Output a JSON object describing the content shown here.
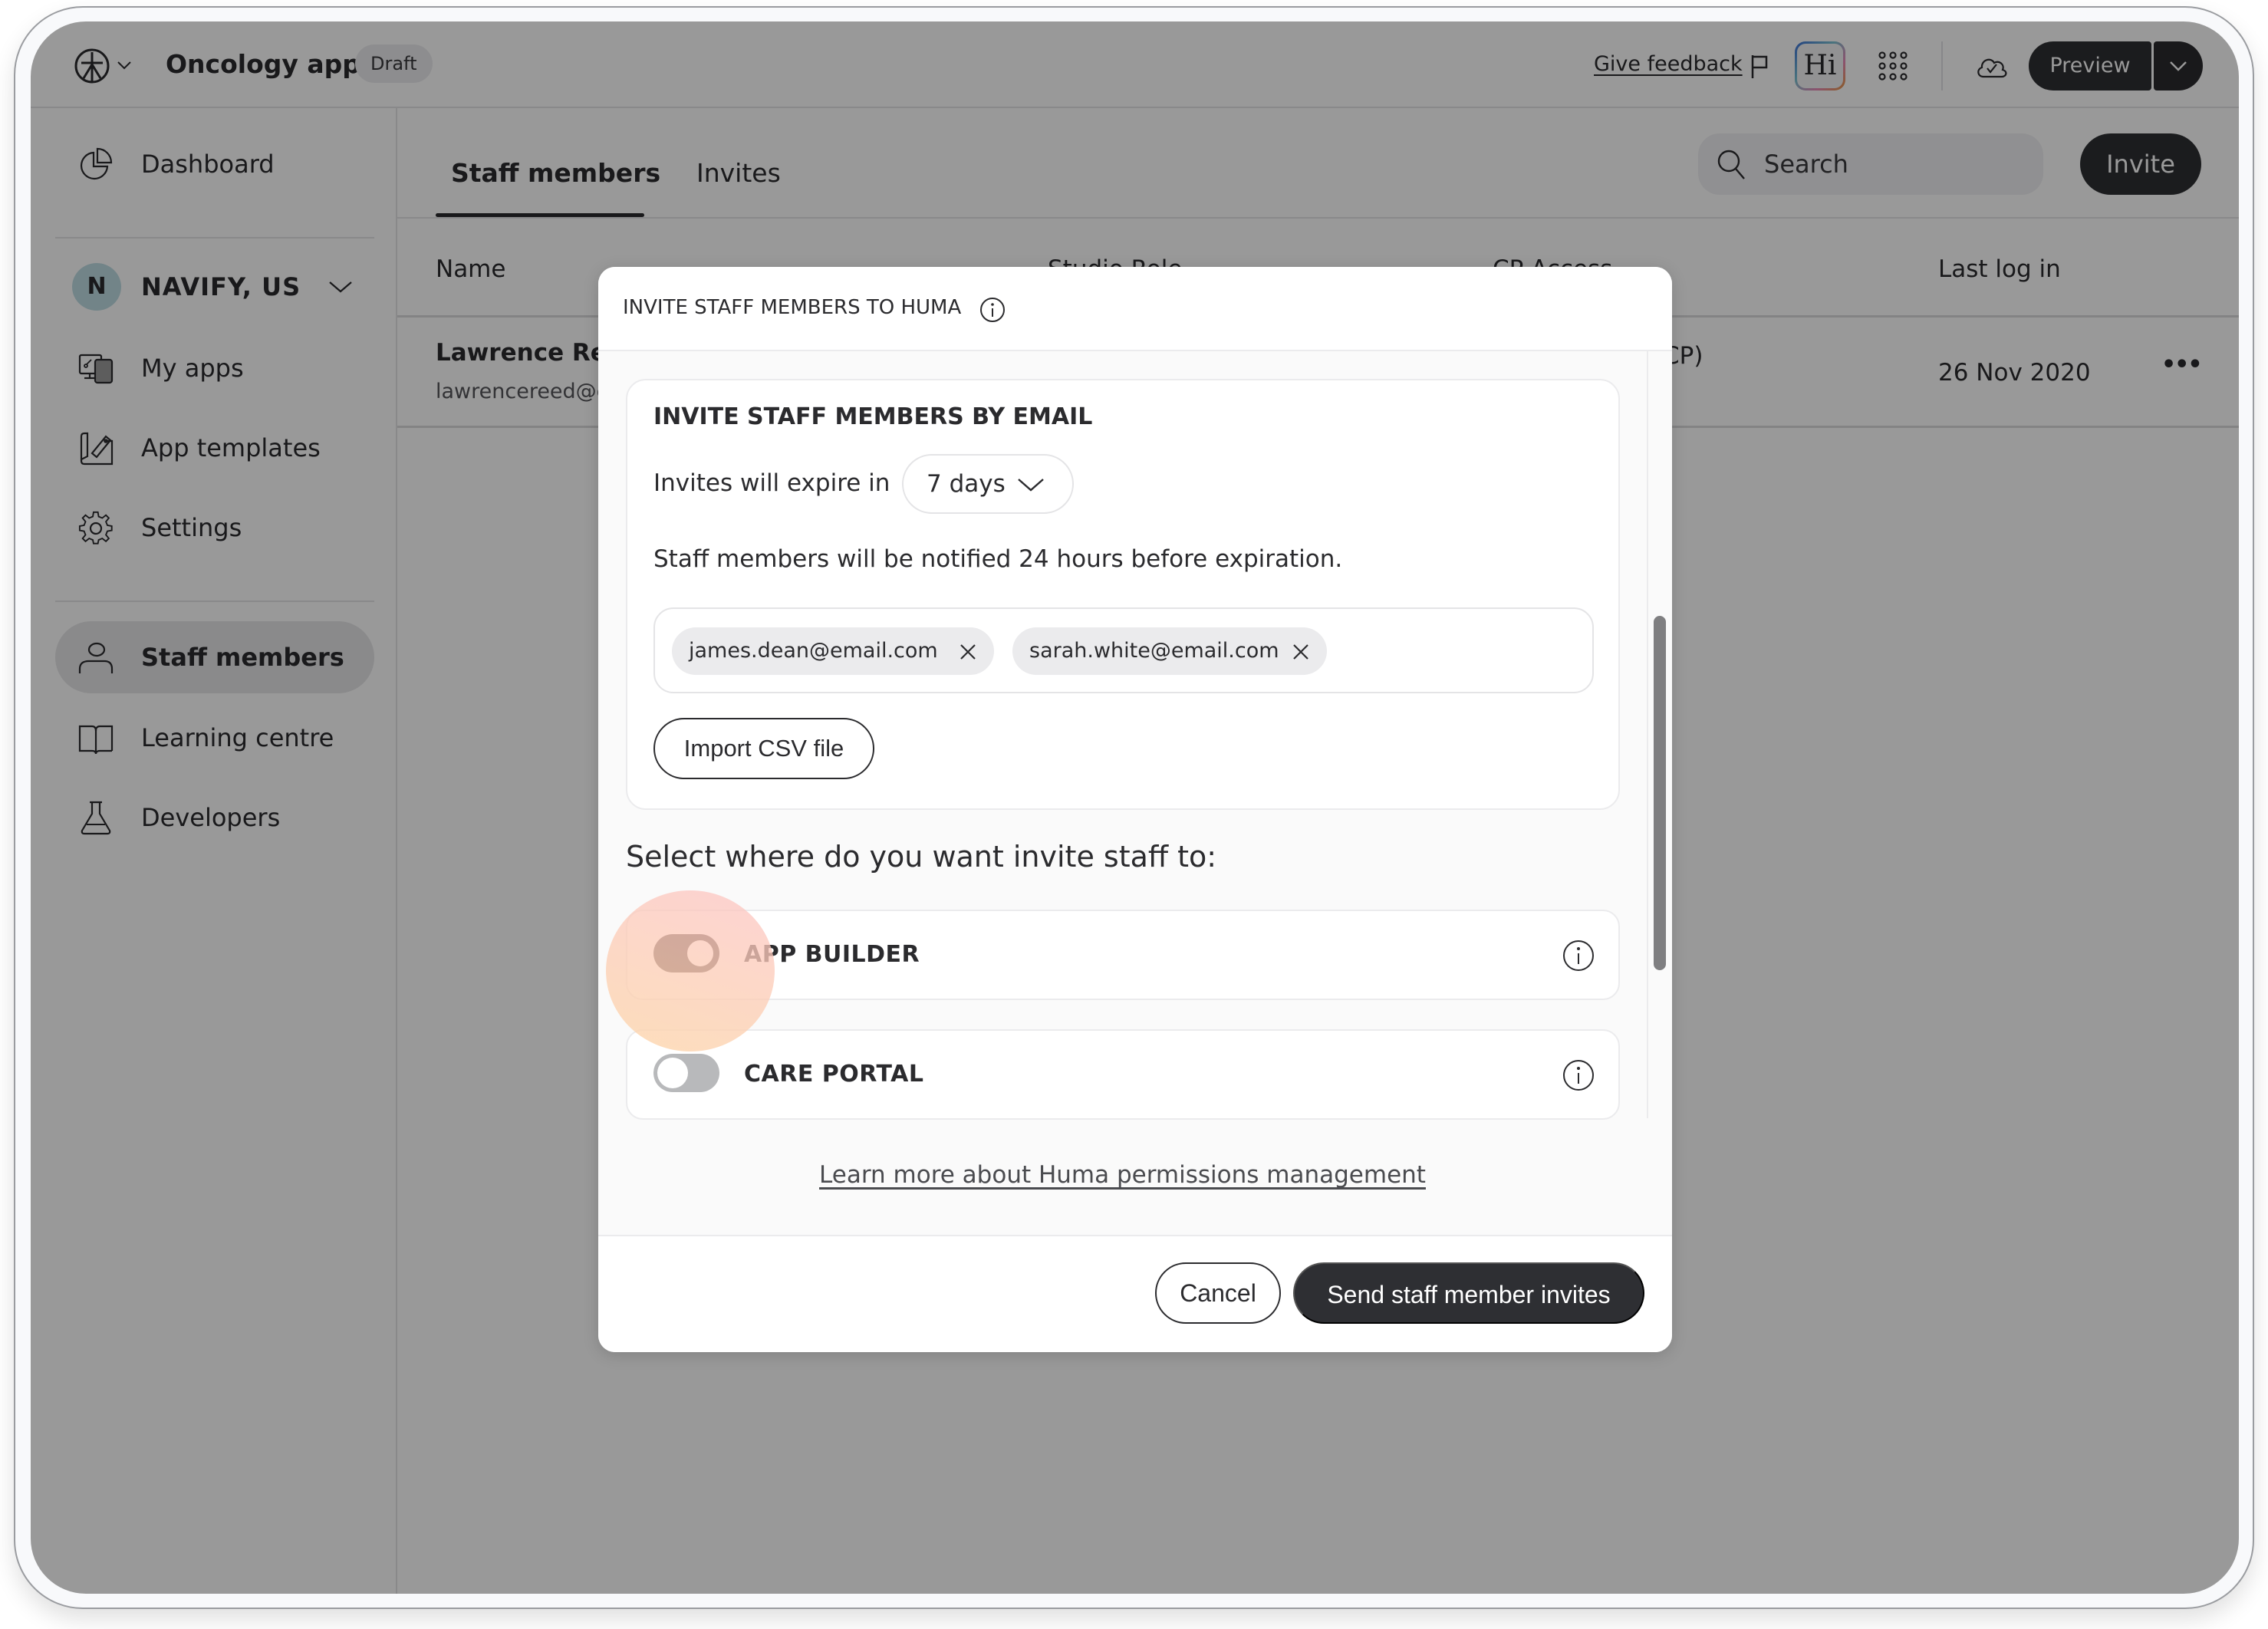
{
  "header": {
    "logo_icon": "huma-logo-icon",
    "app_title": "Oncology app",
    "status_badge": "Draft",
    "feedback_link": "Give feedback",
    "ai_badge": "Hi",
    "preview_button": "Preview"
  },
  "sidebar": {
    "top_items": [
      {
        "label": "Dashboard",
        "icon": "pie-chart-icon"
      }
    ],
    "org": {
      "initial": "N",
      "name": "NAVIFY, US"
    },
    "org_items": [
      {
        "label": "My apps",
        "icon": "devices-icon"
      },
      {
        "label": "App templates",
        "icon": "blueprint-icon"
      },
      {
        "label": "Settings",
        "icon": "gear-icon"
      }
    ],
    "bottom_items": [
      {
        "label": "Staff members",
        "icon": "person-icon",
        "active": true
      },
      {
        "label": "Learning centre",
        "icon": "book-icon"
      },
      {
        "label": "Developers",
        "icon": "flask-icon"
      }
    ]
  },
  "main": {
    "tabs": [
      {
        "label": "Staff members",
        "active": true
      },
      {
        "label": "Invites",
        "active": false
      }
    ],
    "search_placeholder": "Search",
    "invite_button": "Invite",
    "table": {
      "columns": [
        "Name",
        "Studio Role",
        "CP Access",
        "Last log in"
      ],
      "rows": [
        {
          "name": "Lawrence Ree",
          "email": "lawrencereed@e",
          "cp_access_partial": "CP)",
          "last_log_in": "26 Nov 2020",
          "more": "•••"
        }
      ]
    }
  },
  "modal": {
    "title": "INVITE STAFF MEMBERS TO HUMA",
    "email_section": {
      "title": "INVITE STAFF MEMBERS BY EMAIL",
      "expire_label": "Invites will expire in",
      "expire_value": "7 days",
      "notify_text": "Staff members will be notified 24 hours before expiration.",
      "emails": [
        "james.dean@email.com",
        "sarah.white@email.com"
      ],
      "import_button": "Import CSV file"
    },
    "select_heading": "Select where do you want invite staff to:",
    "permissions": [
      {
        "label": "APP BUILDER",
        "enabled": true
      },
      {
        "label": "CARE PORTAL",
        "enabled": false
      }
    ],
    "learn_more_link": "Learn more about Huma permissions management",
    "cancel_button": "Cancel",
    "send_button": "Send staff member invites",
    "scroll_position": 0.35
  },
  "colors": {
    "primary_dark": "#2e2f33",
    "toggle_on": "#473b3a",
    "toggle_off": "#b8b9bb",
    "org_avatar": "#bfdde3"
  }
}
